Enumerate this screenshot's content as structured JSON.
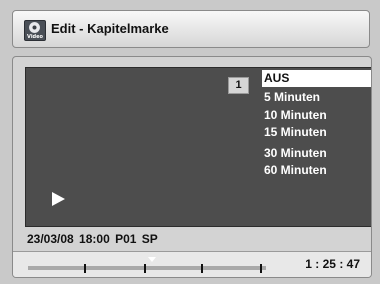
{
  "header": {
    "title": "Edit - Kapitelmarke",
    "icon": "video-disc-icon",
    "icon_label": "Video"
  },
  "preview": {
    "chapter_number": "1",
    "play_icon": "play-icon"
  },
  "menu": {
    "items": [
      {
        "label": "AUS",
        "selected": true
      },
      {
        "label": "5 Minuten",
        "selected": false
      },
      {
        "label": "10 Minuten",
        "selected": false
      },
      {
        "label": "15 Minuten",
        "selected": false
      },
      {
        "label": "30 Minuten",
        "selected": false
      },
      {
        "label": "60 Minuten",
        "selected": false
      }
    ]
  },
  "status": {
    "info": "23/03/08 18:00 P01 SP",
    "time": "1 : 25 : 47"
  },
  "timeline": {
    "chapter_marks": [
      0.24,
      0.49,
      0.73,
      0.98
    ],
    "position": 0.52
  },
  "colors": {
    "selected_background": "#ffffff",
    "preview_background": "#4d4d4d",
    "panel_background": "#d3d3d3"
  }
}
